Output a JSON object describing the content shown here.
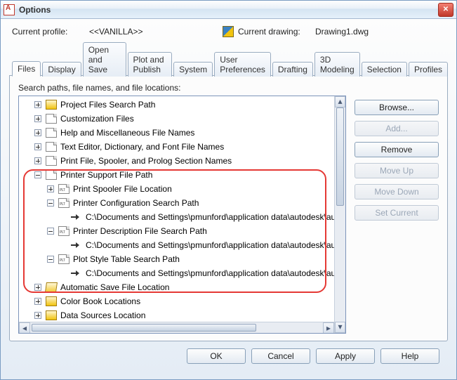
{
  "window": {
    "title": "Options"
  },
  "profile": {
    "label": "Current profile:",
    "value": "<<VANILLA>>",
    "drawing_label": "Current drawing:",
    "drawing_value": "Drawing1.dwg"
  },
  "tabs": [
    "Files",
    "Display",
    "Open and Save",
    "Plot and Publish",
    "System",
    "User Preferences",
    "Drafting",
    "3D Modeling",
    "Selection",
    "Profiles"
  ],
  "active_tab": 0,
  "tree_title": "Search paths, file names, and file locations:",
  "tree": [
    {
      "indent": 1,
      "exp": "plus",
      "icon": "folder",
      "label": "Project Files Search Path"
    },
    {
      "indent": 1,
      "exp": "plus",
      "icon": "page",
      "label": "Customization Files"
    },
    {
      "indent": 1,
      "exp": "plus",
      "icon": "page",
      "label": "Help and Miscellaneous File Names"
    },
    {
      "indent": 1,
      "exp": "plus",
      "icon": "page",
      "label": "Text Editor, Dictionary, and Font File Names"
    },
    {
      "indent": 1,
      "exp": "plus",
      "icon": "page",
      "label": "Print File, Spooler, and Prolog Section Names"
    },
    {
      "indent": 1,
      "exp": "minus",
      "icon": "page",
      "label": "Printer Support File Path"
    },
    {
      "indent": 2,
      "exp": "plus",
      "icon": "page plt",
      "label": "Print Spooler File Location"
    },
    {
      "indent": 2,
      "exp": "minus",
      "icon": "page plt",
      "label": "Printer Configuration Search Path"
    },
    {
      "indent": 3,
      "exp": "none",
      "icon": "arrow",
      "label": "C:\\Documents and Settings\\pmunford\\application data\\autodesk\\autocad"
    },
    {
      "indent": 2,
      "exp": "minus",
      "icon": "page plt",
      "label": "Printer Description File Search Path"
    },
    {
      "indent": 3,
      "exp": "none",
      "icon": "arrow",
      "label": "C:\\Documents and Settings\\pmunford\\application data\\autodesk\\autocad"
    },
    {
      "indent": 2,
      "exp": "minus",
      "icon": "page plt",
      "label": "Plot Style Table Search Path"
    },
    {
      "indent": 3,
      "exp": "none",
      "icon": "arrow",
      "label": "C:\\Documents and Settings\\pmunford\\application data\\autodesk\\autocad"
    },
    {
      "indent": 1,
      "exp": "plus",
      "icon": "folderopen",
      "label": "Automatic Save File Location"
    },
    {
      "indent": 1,
      "exp": "plus",
      "icon": "folder",
      "label": "Color Book Locations"
    },
    {
      "indent": 1,
      "exp": "plus",
      "icon": "folder",
      "label": "Data Sources Location"
    }
  ],
  "buttons": {
    "browse": "Browse...",
    "add": "Add...",
    "remove": "Remove",
    "moveup": "Move Up",
    "movedown": "Move Down",
    "setcurrent": "Set Current"
  },
  "dialog_buttons": {
    "ok": "OK",
    "cancel": "Cancel",
    "apply": "Apply",
    "help": "Help"
  }
}
